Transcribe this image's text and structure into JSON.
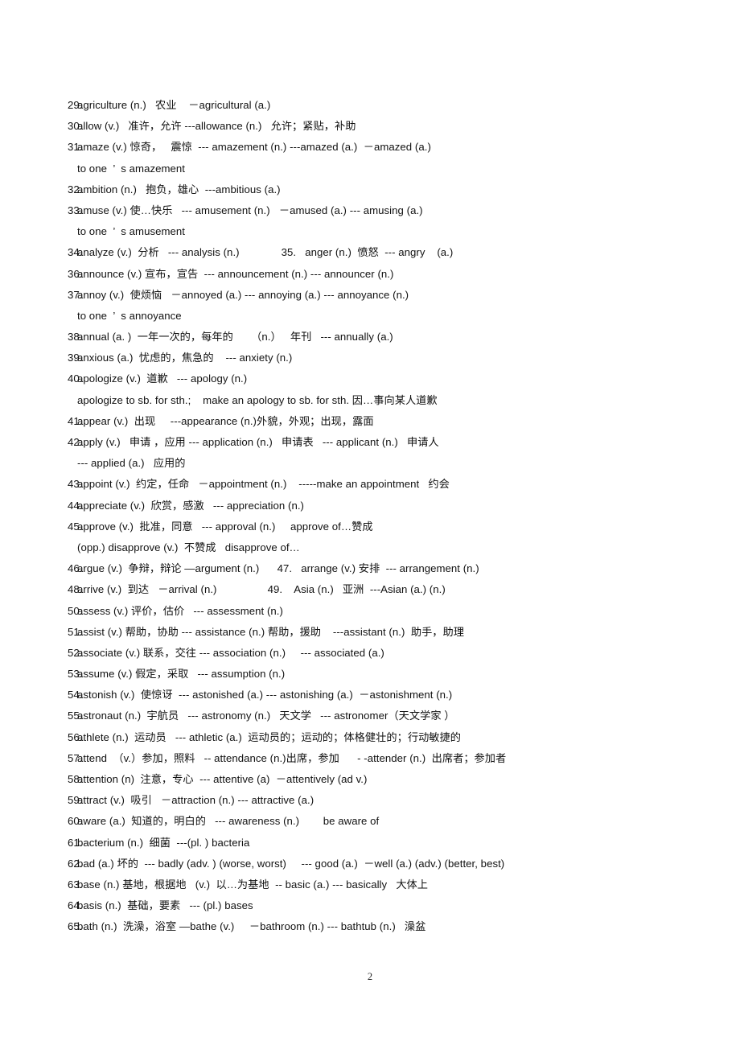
{
  "document": {
    "page_number": "2",
    "type": "vocabulary-word-list"
  },
  "entries": [
    {
      "number": "29.",
      "lines": [
        "agriculture (n.)   农业    －agricultural (a.)"
      ]
    },
    {
      "number": "30.",
      "lines": [
        "allow (v.)   准许，允许 ---allowance (n.)   允许；紧贴，补助"
      ]
    },
    {
      "number": "31.",
      "lines": [
        "amaze (v.) 惊奇，   震惊  --- amazement (n.) ---amazed (a.)  －amazed (a.)",
        "to one  ’  s amazement"
      ]
    },
    {
      "number": "32.",
      "lines": [
        "ambition (n.)   抱负，雄心  ---ambitious (a.)"
      ]
    },
    {
      "number": "33.",
      "lines": [
        "amuse (v.) 使…快乐   --- amusement (n.)   －amused (a.) --- amusing (a.)",
        "to one  ’  s amusement"
      ]
    },
    {
      "number": "34.",
      "lines": [
        "analyze (v.)  分析   --- analysis (n.)              35.   anger (n.)  愤怒  --- angry    (a.)"
      ]
    },
    {
      "number": "36.",
      "lines": [
        "announce (v.) 宣布，宣告  --- announcement (n.) --- announcer (n.)"
      ]
    },
    {
      "number": "37.",
      "lines": [
        "annoy (v.)  使烦恼   －annoyed (a.) --- annoying (a.) --- annoyance (n.)",
        "to one  ’  s annoyance"
      ]
    },
    {
      "number": "38.",
      "lines": [
        "annual (a. )  一年一次的，每年的      （n.）   年刊   --- annually (a.)"
      ]
    },
    {
      "number": "39.",
      "lines": [
        "anxious (a.)  忧虑的，焦急的    --- anxiety (n.)"
      ]
    },
    {
      "number": "40.",
      "lines": [
        "apologize (v.)  道歉   --- apology (n.)",
        "apologize to sb. for sth.;    make an apology to sb. for sth. 因…事向某人道歉"
      ]
    },
    {
      "number": "41.",
      "lines": [
        "appear (v.)  出现     ---appearance (n.)外貌，外观；出现，露面"
      ]
    },
    {
      "number": "42.",
      "lines": [
        "apply (v.)   申请 ，应用 --- application (n.)   申请表   --- applicant (n.)   申请人",
        "--- applied (a.)   应用的"
      ]
    },
    {
      "number": "43.",
      "lines": [
        "appoint (v.)  约定，任命   －appointment (n.)    -----make an appointment   约会"
      ]
    },
    {
      "number": "44.",
      "lines": [
        "appreciate (v.)  欣赏，感激   --- appreciation (n.)"
      ]
    },
    {
      "number": "45.",
      "lines": [
        "approve (v.)  批准，同意   --- approval (n.)     approve of…赞成",
        "(opp.) disapprove (v.)  不赞成   disapprove of…"
      ]
    },
    {
      "number": "46.",
      "lines": [
        "argue (v.)  争辩，辩论 —argument (n.)      47.   arrange (v.) 安排  --- arrangement (n.)"
      ]
    },
    {
      "number": "48.",
      "lines": [
        "arrive (v.)  到达   －arrival (n.)                 49.    Asia (n.)   亚洲  ---Asian (a.) (n.)"
      ]
    },
    {
      "number": "50.",
      "lines": [
        "assess (v.) 评价，估价   --- assessment (n.)"
      ]
    },
    {
      "number": "51.",
      "lines": [
        "assist (v.) 帮助，协助 --- assistance (n.) 帮助，援助    ---assistant (n.)  助手，助理"
      ]
    },
    {
      "number": "52.",
      "lines": [
        "associate (v.) 联系，交往 --- association (n.)     --- associated (a.)"
      ]
    },
    {
      "number": "53.",
      "lines": [
        "assume (v.) 假定，采取   --- assumption (n.)"
      ]
    },
    {
      "number": "54.",
      "lines": [
        "astonish (v.)  使惊讶  --- astonished (a.) --- astonishing (a.)  －astonishment (n.)"
      ]
    },
    {
      "number": "55.",
      "lines": [
        "astronaut (n.)  宇航员   --- astronomy (n.)   天文学   --- astronomer（天文学家 ）"
      ]
    },
    {
      "number": "56.",
      "lines": [
        "athlete (n.)  运动员   --- athletic (a.)  运动员的；运动的；体格健壮的；行动敏捷的"
      ]
    },
    {
      "number": "57.",
      "lines": [
        "attend  （v.）参加，照料   -- attendance (n.)出席，参加      - -attender (n.)  出席者；参加者"
      ]
    },
    {
      "number": "58.",
      "lines": [
        "attention (n)  注意，专心  --- attentive (a)  －attentively (ad v.)"
      ]
    },
    {
      "number": "59.",
      "lines": [
        "attract (v.)  吸引   －attraction (n.) --- attractive (a.)"
      ]
    },
    {
      "number": "60.",
      "lines": [
        "aware (a.)  知道的，明白的   --- awareness (n.)        be aware of"
      ]
    },
    {
      "number": "61.",
      "lines": [
        "bacterium (n.)  细菌  ---(pl. ) bacteria"
      ]
    },
    {
      "number": "62.",
      "lines": [
        "bad (a.) 坏的  --- badly (adv. ) (worse, worst)     --- good (a.)  －well (a.) (adv.) (better, best)"
      ]
    },
    {
      "number": "63.",
      "lines": [
        "base (n.) 基地，根据地   (v.)  以…为基地  -- basic (a.) --- basically   大体上"
      ]
    },
    {
      "number": "64.",
      "lines": [
        "basis (n.)  基础，要素   --- (pl.) bases"
      ]
    },
    {
      "number": "65.",
      "lines": [
        "bath (n.)  洗澡，浴室 —bathe (v.)     －bathroom (n.) --- bathtub (n.)   澡盆"
      ]
    }
  ]
}
